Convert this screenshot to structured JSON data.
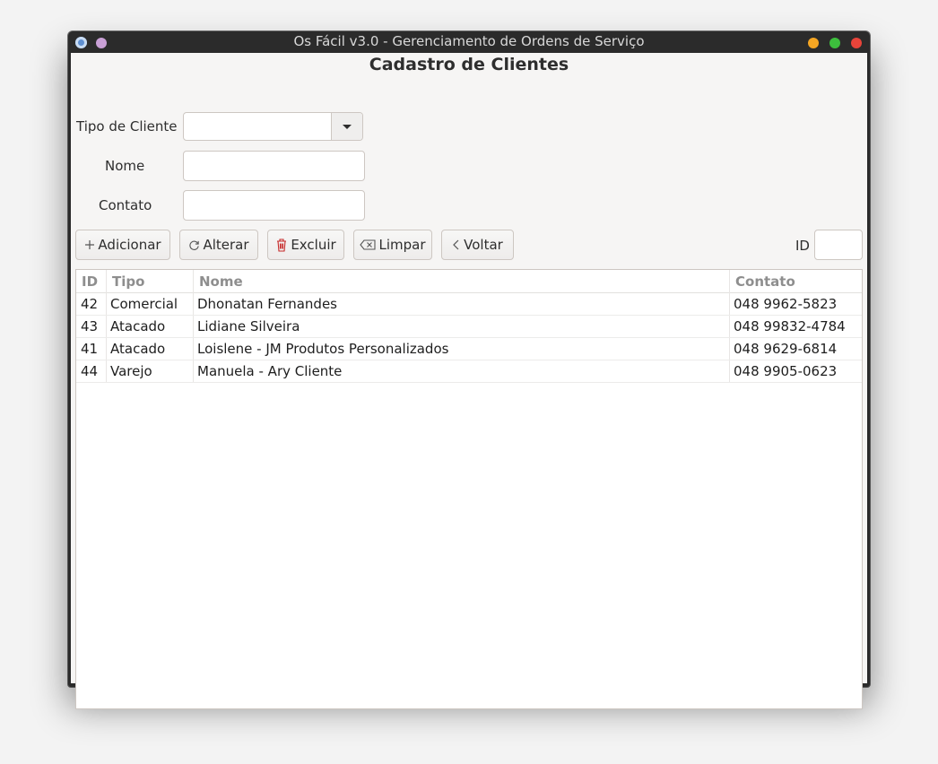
{
  "window": {
    "title": "Os Fácil v3.0 - Gerenciamento de Ordens de Serviço",
    "controls": {
      "minimize_color": "#f5a623",
      "maximize_color": "#3dbf3d",
      "close_color": "#e8443a"
    }
  },
  "form": {
    "heading": "Cadastro de Clientes",
    "tipo_label": "Tipo de Cliente",
    "tipo_value": "",
    "nome_label": "Nome",
    "nome_value": "",
    "contato_label": "Contato",
    "contato_value": ""
  },
  "toolbar": {
    "add_label": "Adicionar",
    "edit_label": "Alterar",
    "delete_label": "Excluir",
    "clear_label": "Limpar",
    "back_label": "Voltar",
    "id_label": "ID",
    "id_value": ""
  },
  "table": {
    "columns": [
      "ID",
      "Tipo",
      "Nome",
      "Contato"
    ],
    "rows": [
      [
        "42",
        "Comercial",
        "Dhonatan Fernandes",
        "048 9962-5823"
      ],
      [
        "43",
        "Atacado",
        "Lidiane Silveira",
        "048 99832-4784"
      ],
      [
        "41",
        "Atacado",
        "Loislene - JM Produtos Personalizados",
        "048 9629-6814"
      ],
      [
        "44",
        "Varejo",
        "Manuela - Ary Cliente",
        "048 9905-0623"
      ]
    ]
  },
  "icons": {
    "add": "plus-icon",
    "edit": "refresh-icon",
    "delete": "trash-icon",
    "clear": "backspace-icon",
    "back": "chevron-left-icon"
  },
  "colors": {
    "delete_icon": "#c62828",
    "header_text": "#8e8e8e"
  }
}
